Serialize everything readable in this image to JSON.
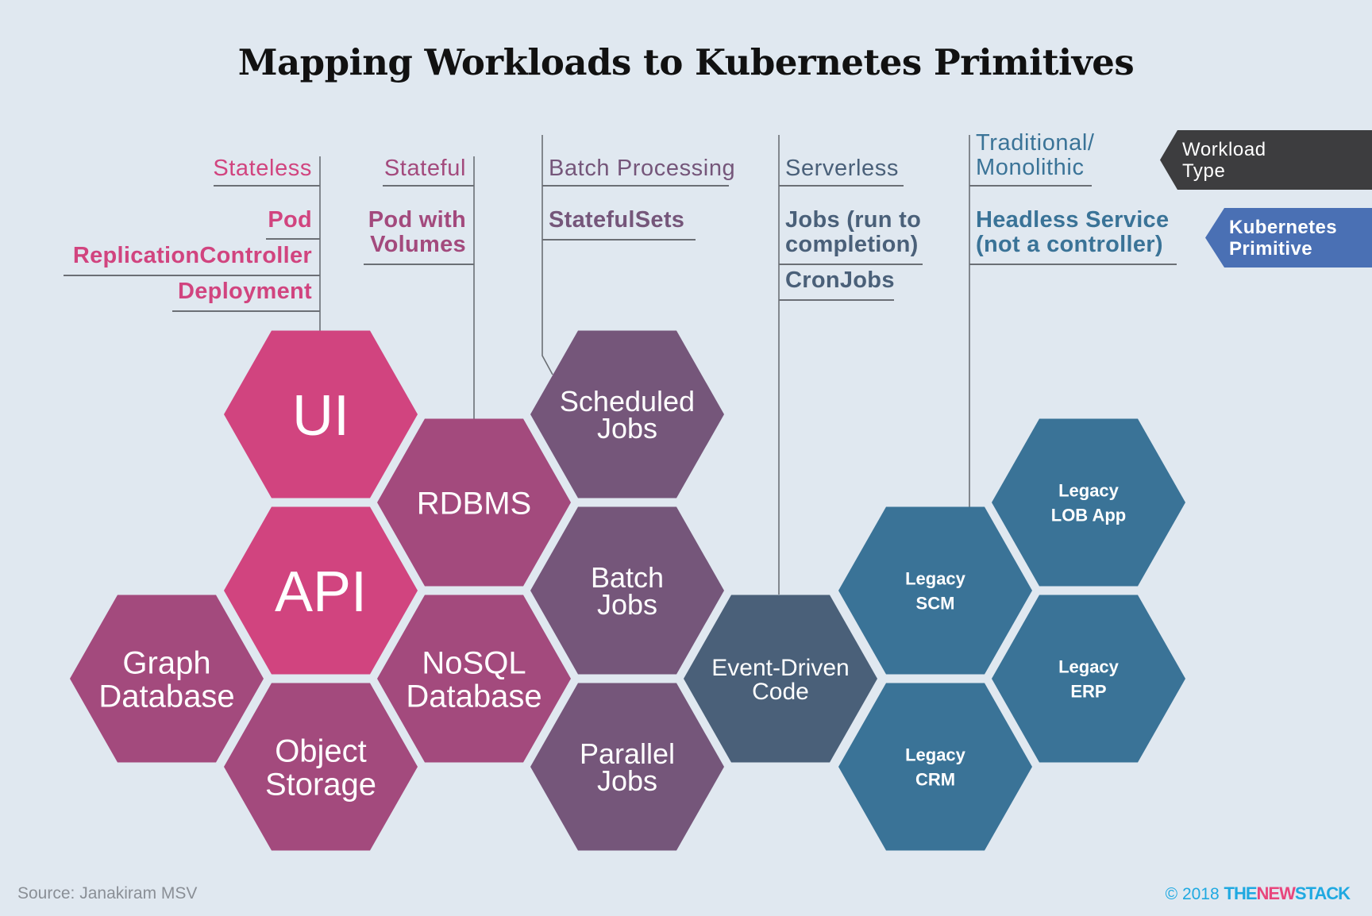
{
  "title": "Mapping Workloads to Kubernetes Primitives",
  "colors": {
    "background": "#e0e8f0",
    "line": "#6b6f75",
    "stateless": "#d1447f",
    "stateful": "#a34a7d",
    "batch": "#75567a",
    "serverless": "#4a6079",
    "traditional": "#3a7397",
    "legend_workload": "#3d3d3f",
    "legend_primitive": "#4a70b4"
  },
  "columns": [
    {
      "id": "stateless",
      "workload_type": "Stateless",
      "primitives": [
        "Pod",
        "ReplicationController",
        "Deployment"
      ],
      "label_color": "#d1447f"
    },
    {
      "id": "stateful",
      "workload_type": "Stateful",
      "primitives": [
        "Pod with\nVolumes"
      ],
      "label_color": "#a34a7d"
    },
    {
      "id": "batch",
      "workload_type": "Batch Processing",
      "primitives": [
        "StatefulSets"
      ],
      "label_color": "#75567a"
    },
    {
      "id": "serverless",
      "workload_type": "Serverless",
      "primitives": [
        "Jobs (run to\ncompletion)",
        "CronJobs"
      ],
      "label_color": "#4a6079"
    },
    {
      "id": "traditional",
      "workload_type": "Traditional/\nMonolithic",
      "primitives": [
        "Headless Service\n(not a controller)"
      ],
      "label_color": "#3a7397"
    }
  ],
  "legend": {
    "workload_type": "Workload\nType",
    "kubernetes_primitive": "Kubernetes\nPrimitive"
  },
  "hexagons": [
    {
      "label": "UI",
      "group": "stateless",
      "color": "#d1447f",
      "col": 1,
      "row": 0,
      "style": "thin-large"
    },
    {
      "label": "API",
      "group": "stateless",
      "color": "#d1447f",
      "col": 1,
      "row": 2,
      "style": "thin-large"
    },
    {
      "label": "Object\nStorage",
      "group": "stateful",
      "color": "#a34a7d",
      "col": 1,
      "row": 4,
      "style": "light"
    },
    {
      "label": "Graph\nDatabase",
      "group": "stateful",
      "color": "#a34a7d",
      "col": 0,
      "row": 3,
      "style": "light"
    },
    {
      "label": "RDBMS",
      "group": "stateful",
      "color": "#a34a7d",
      "col": 2,
      "row": 1,
      "style": "light"
    },
    {
      "label": "NoSQL\nDatabase",
      "group": "stateful",
      "color": "#a34a7d",
      "col": 2,
      "row": 3,
      "style": "light"
    },
    {
      "label": "Scheduled\nJobs",
      "group": "batch",
      "color": "#75567a",
      "col": 3,
      "row": 0,
      "style": "regular"
    },
    {
      "label": "Batch\nJobs",
      "group": "batch",
      "color": "#75567a",
      "col": 3,
      "row": 2,
      "style": "regular"
    },
    {
      "label": "Parallel\nJobs",
      "group": "batch",
      "color": "#75567a",
      "col": 3,
      "row": 4,
      "style": "regular"
    },
    {
      "label": "Event-Driven\nCode",
      "group": "serverless",
      "color": "#4a6079",
      "col": 4,
      "row": 3,
      "style": "medium"
    },
    {
      "label": "Legacy\nSCM",
      "group": "traditional",
      "color": "#3a7397",
      "col": 5,
      "row": 2,
      "style": "bold"
    },
    {
      "label": "Legacy\nCRM",
      "group": "traditional",
      "color": "#3a7397",
      "col": 5,
      "row": 4,
      "style": "bold"
    },
    {
      "label": "Legacy\nLOB App",
      "group": "traditional",
      "color": "#3a7397",
      "col": 6,
      "row": 1,
      "style": "bold"
    },
    {
      "label": "Legacy\nERP",
      "group": "traditional",
      "color": "#3a7397",
      "col": 6,
      "row": 3,
      "style": "bold"
    }
  ],
  "footer": {
    "source": "Source: Janakiram MSV",
    "copyright": "© 2018",
    "brand_the": "THE",
    "brand_new": "NEW",
    "brand_stack": "STACK"
  }
}
